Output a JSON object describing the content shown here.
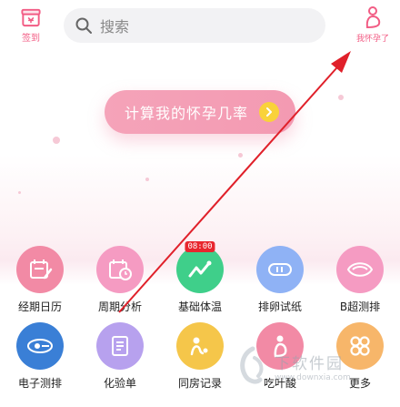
{
  "header": {
    "checkin_label": "签到",
    "search_placeholder": "搜索",
    "pregnant_label": "我怀孕了"
  },
  "cta": {
    "label": "计算我的怀孕几率"
  },
  "tools": [
    {
      "label": "经期日历",
      "color": "#f28aa5"
    },
    {
      "label": "周期分析",
      "color": "#f59bc2"
    },
    {
      "label": "基础体温",
      "color": "#3fcf8a",
      "badge": "08:00"
    },
    {
      "label": "排卵试纸",
      "color": "#8fb2f5"
    },
    {
      "label": "B超测排",
      "color": "#f59bc2"
    },
    {
      "label": "电子测排",
      "color": "#3a7fd6"
    },
    {
      "label": "化验单",
      "color": "#b7a1ee"
    },
    {
      "label": "同房记录",
      "color": "#f5c64a"
    },
    {
      "label": "吃叶酸",
      "color": "#f28aa5"
    },
    {
      "label": "更多",
      "color": "#f7b66a"
    }
  ],
  "watermark": {
    "main": "下软件园",
    "sub": "www.downxia.com"
  },
  "colors": {
    "brand_pink": "#f25c84",
    "cta_pink": "#f39ab2",
    "annotation_red": "#e0202a"
  }
}
